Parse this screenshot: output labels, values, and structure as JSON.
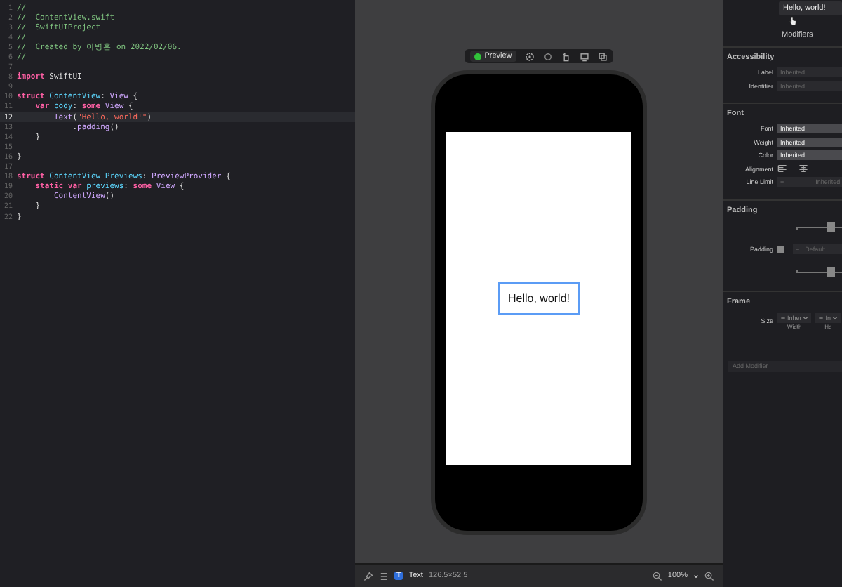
{
  "editor": {
    "lines": [
      {
        "number": "1",
        "current": false,
        "tokens": [
          {
            "kind": "comment",
            "text": "//"
          }
        ]
      },
      {
        "number": "2",
        "current": false,
        "tokens": [
          {
            "kind": "comment",
            "text": "//  ContentView.swift"
          }
        ]
      },
      {
        "number": "3",
        "current": false,
        "tokens": [
          {
            "kind": "comment",
            "text": "//  SwiftUIProject"
          }
        ]
      },
      {
        "number": "4",
        "current": false,
        "tokens": [
          {
            "kind": "comment",
            "text": "//"
          }
        ]
      },
      {
        "number": "5",
        "current": false,
        "tokens": [
          {
            "kind": "comment",
            "text": "//  Created by 이병훈 on 2022/02/06."
          }
        ]
      },
      {
        "number": "6",
        "current": false,
        "tokens": [
          {
            "kind": "comment",
            "text": "//"
          }
        ]
      },
      {
        "number": "7",
        "current": false
      },
      {
        "number": "8",
        "current": false,
        "tokens": [
          {
            "kind": "keyword",
            "text": "import"
          },
          {
            "kind": "plain",
            "text": " SwiftUI"
          }
        ]
      },
      {
        "number": "9",
        "current": false
      },
      {
        "number": "10",
        "current": false,
        "tokens": [
          {
            "kind": "keyword",
            "text": "struct"
          },
          {
            "kind": "decl",
            "text": " ContentView"
          },
          {
            "kind": "plain",
            "text": ": "
          },
          {
            "kind": "type",
            "text": "View"
          },
          {
            "kind": "plain",
            "text": " {"
          }
        ]
      },
      {
        "number": "11",
        "current": false,
        "tokens": [
          {
            "kind": "keyword",
            "text": "    var"
          },
          {
            "kind": "decl",
            "text": " body"
          },
          {
            "kind": "plain",
            "text": ": "
          },
          {
            "kind": "keyword",
            "text": "some"
          },
          {
            "kind": "type",
            "text": " View"
          },
          {
            "kind": "plain",
            "text": " {"
          }
        ]
      },
      {
        "number": "12",
        "current": true,
        "tokens": [
          {
            "kind": "type",
            "text": "        Text"
          },
          {
            "kind": "plain",
            "text": "("
          },
          {
            "kind": "string",
            "text": "\"Hello, world!\""
          },
          {
            "kind": "plain",
            "text": ")"
          }
        ]
      },
      {
        "number": "13",
        "current": false,
        "tokens": [
          {
            "kind": "plain",
            "text": "            ."
          },
          {
            "kind": "type",
            "text": "padding"
          },
          {
            "kind": "plain",
            "text": "()"
          }
        ]
      },
      {
        "number": "14",
        "current": false,
        "tokens": [
          {
            "kind": "plain",
            "text": "    }"
          }
        ]
      },
      {
        "number": "15",
        "current": false
      },
      {
        "number": "16",
        "current": false,
        "tokens": [
          {
            "kind": "plain",
            "text": "}"
          }
        ]
      },
      {
        "number": "17",
        "current": false
      },
      {
        "number": "18",
        "current": false,
        "tokens": [
          {
            "kind": "keyword",
            "text": "struct"
          },
          {
            "kind": "decl",
            "text": " ContentView_Previews"
          },
          {
            "kind": "plain",
            "text": ": "
          },
          {
            "kind": "type",
            "text": "PreviewProvider"
          },
          {
            "kind": "plain",
            "text": " {"
          }
        ]
      },
      {
        "number": "19",
        "current": false,
        "tokens": [
          {
            "kind": "keyword",
            "text": "    static var"
          },
          {
            "kind": "decl",
            "text": " previews"
          },
          {
            "kind": "plain",
            "text": ": "
          },
          {
            "kind": "keyword",
            "text": "some"
          },
          {
            "kind": "type",
            "text": " View"
          },
          {
            "kind": "plain",
            "text": " {"
          }
        ]
      },
      {
        "number": "20",
        "current": false,
        "tokens": [
          {
            "kind": "type",
            "text": "        ContentView"
          },
          {
            "kind": "plain",
            "text": "()"
          }
        ]
      },
      {
        "number": "21",
        "current": false,
        "tokens": [
          {
            "kind": "plain",
            "text": "    }"
          }
        ]
      },
      {
        "number": "22",
        "current": false,
        "tokens": [
          {
            "kind": "plain",
            "text": "}"
          }
        ]
      }
    ]
  },
  "canvas": {
    "preview_button": "Preview",
    "preview_text": "Hello, world!",
    "status_bar": {
      "element_badge": "T",
      "element_name": "Text",
      "element_size": "126.5×52.5",
      "zoom": "100%"
    }
  },
  "inspector": {
    "text_value": "Hello, world!",
    "tab": "Modifiers",
    "sections": [
      {
        "title": "Accessibility",
        "rows": [
          {
            "kind": "field",
            "label": "Label",
            "placeholder": "Inherited"
          },
          {
            "kind": "field",
            "label": "Identifier",
            "placeholder": "Inherited"
          }
        ]
      },
      {
        "title": "Font",
        "rows": [
          {
            "kind": "select",
            "label": "Font",
            "value": "Inherited"
          },
          {
            "kind": "select",
            "label": "Weight",
            "value": "Inherited"
          },
          {
            "kind": "select",
            "label": "Color",
            "value": "Inherited"
          },
          {
            "kind": "alignment",
            "label": "Alignment"
          },
          {
            "kind": "stepper",
            "label": "Line Limit",
            "minus": "−",
            "placeholder": "Inherited"
          }
        ]
      },
      {
        "title": "Padding",
        "rows": [
          {
            "kind": "padding",
            "label": "Padding",
            "checked": false,
            "minus": "−",
            "placeholder": "Default"
          }
        ]
      },
      {
        "title": "Frame",
        "rows": [
          {
            "kind": "size",
            "label": "Size",
            "fields": [
              {
                "value": "Inher",
                "caption": "Width"
              },
              {
                "value": "In",
                "caption": "He"
              }
            ]
          }
        ]
      }
    ],
    "add_modifier_placeholder": "Add Modifier"
  }
}
